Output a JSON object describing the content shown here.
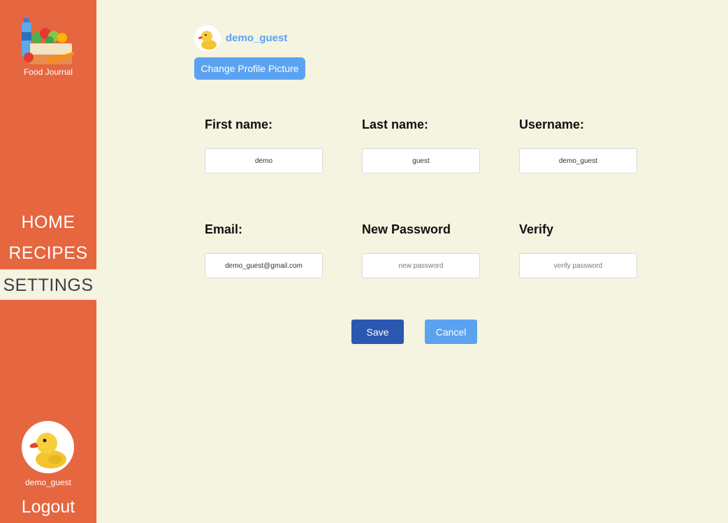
{
  "sidebar": {
    "logo_icon": "food-basket-icon",
    "logo_text": "Food Journal",
    "nav": [
      {
        "label": "HOME",
        "active": false
      },
      {
        "label": "RECIPES",
        "active": false
      },
      {
        "label": "SETTINGS",
        "active": true
      }
    ],
    "avatar_icon": "rubber-duck-avatar",
    "username": "demo_guest",
    "logout_label": "Logout"
  },
  "profile": {
    "avatar_icon": "rubber-duck-avatar",
    "username": "demo_guest",
    "change_picture_label": "Change Profile Picture"
  },
  "form": {
    "first_name": {
      "label": "First name:",
      "value": "demo",
      "placeholder": ""
    },
    "last_name": {
      "label": "Last name:",
      "value": "guest",
      "placeholder": ""
    },
    "username": {
      "label": "Username:",
      "value": "demo_guest",
      "placeholder": ""
    },
    "email": {
      "label": "Email:",
      "value": "demo_guest@gmail.com",
      "placeholder": ""
    },
    "new_password": {
      "label": "New Password",
      "value": "",
      "placeholder": "new password"
    },
    "verify": {
      "label": "Verify",
      "value": "",
      "placeholder": "verify password"
    }
  },
  "actions": {
    "save_label": "Save",
    "cancel_label": "Cancel"
  },
  "colors": {
    "sidebar_bg": "#e5663f",
    "page_bg": "#f5f4e1",
    "accent": "#5ba3f0",
    "save_bg": "#2a58b0"
  }
}
